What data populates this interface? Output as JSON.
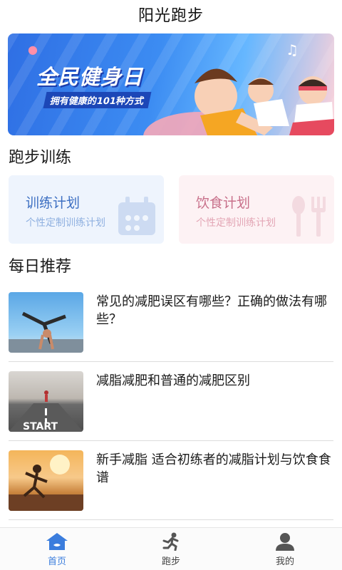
{
  "header": {
    "title": "阳光跑步"
  },
  "banner": {
    "title": "全民健身日",
    "subtitle": "拥有健康的101种方式"
  },
  "sections": {
    "training": "跑步训练",
    "daily": "每日推荐"
  },
  "cards": [
    {
      "title": "训练计划",
      "subtitle": "个性定制训练计划",
      "icon": "calendar-icon"
    },
    {
      "title": "饮食计划",
      "subtitle": "个性定制训练计划",
      "icon": "cutlery-icon"
    }
  ],
  "articles": [
    {
      "title": "常见的减肥误区有哪些？正确的做法有哪些？"
    },
    {
      "title": "减脂减肥和普通的减肥区别"
    },
    {
      "title": "新手减脂 适合初练者的减脂计划与饮食食谱"
    }
  ],
  "tabs": [
    {
      "label": "首页",
      "icon": "home-icon",
      "active": true
    },
    {
      "label": "跑步",
      "icon": "runner-icon",
      "active": false
    },
    {
      "label": "我的",
      "icon": "user-icon",
      "active": false
    }
  ],
  "colors": {
    "accent": "#3b7ddd",
    "train_card": "#eef4fd",
    "diet_card": "#fdf2f4"
  }
}
